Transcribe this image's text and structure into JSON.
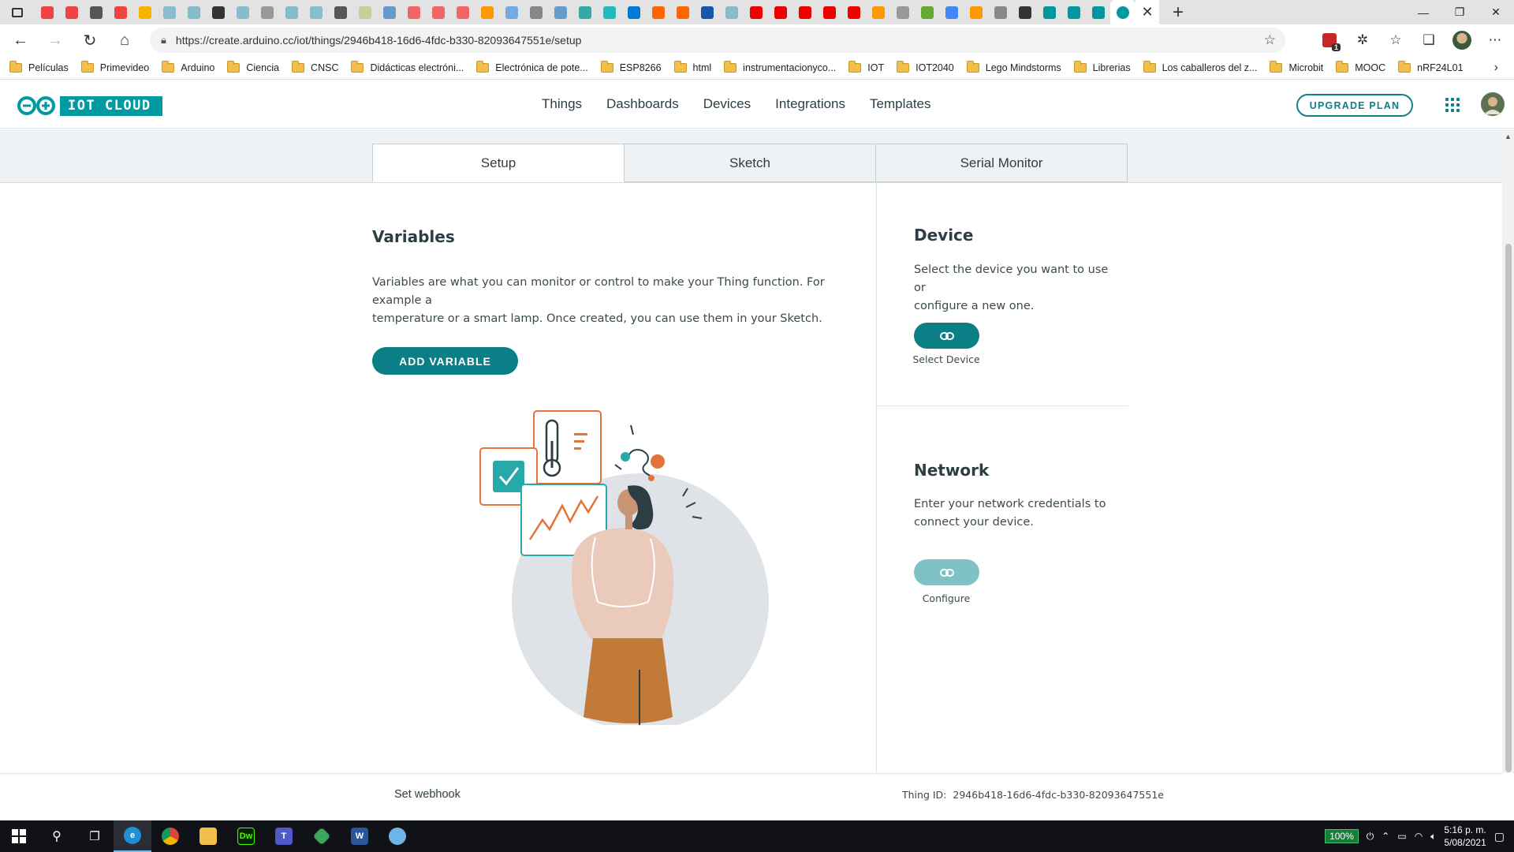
{
  "browser": {
    "address": {
      "url": "https://create.arduino.cc/iot/things/2946b418-16d6-4fdc-b330-82093647551e/setup"
    },
    "bookmarks": [
      "Películas",
      "Primevideo",
      "Arduino",
      "Ciencia",
      "CNSC",
      "Didácticas electróni...",
      "Electrónica de pote...",
      "ESP8266",
      "html",
      "instrumentacionyco...",
      "IOT",
      "IOT2040",
      "Lego Mindstorms",
      "Librerias",
      "Los caballeros del z...",
      "Microbit",
      "MOOC",
      "nRF24L01"
    ],
    "extension_badge": "1"
  },
  "header": {
    "logo_text": "IOT CLOUD",
    "nav": [
      "Things",
      "Dashboards",
      "Devices",
      "Integrations",
      "Templates"
    ],
    "upgrade_label": "UPGRADE PLAN"
  },
  "tabs": [
    "Setup",
    "Sketch",
    "Serial Monitor"
  ],
  "variables": {
    "title": "Variables",
    "text_line1": "Variables are what you can monitor or control to make your Thing function. For example a",
    "text_line2": "temperature or a smart lamp. Once created, you can use them in your Sketch.",
    "add_label": "ADD VARIABLE"
  },
  "device": {
    "title": "Device",
    "text_line1": "Select the device you want to use or",
    "text_line2": "configure a new one.",
    "button_caption": "Select Device"
  },
  "network": {
    "title": "Network",
    "text_line1": "Enter your network credentials to",
    "text_line2": "connect your device.",
    "button_caption": "Configure"
  },
  "footer": {
    "webhook": "Set webhook",
    "thing_id_label": "Thing ID:",
    "thing_id_value": "2946b418-16d6-4fdc-b330-82093647551e"
  },
  "taskbar": {
    "battery": "100%",
    "time": "5:16 p. m.",
    "date": "5/08/2021"
  },
  "colors": {
    "brand": "#009aa0",
    "primary_button": "#0b7f86",
    "disabled_button": "#7fc1c4"
  }
}
